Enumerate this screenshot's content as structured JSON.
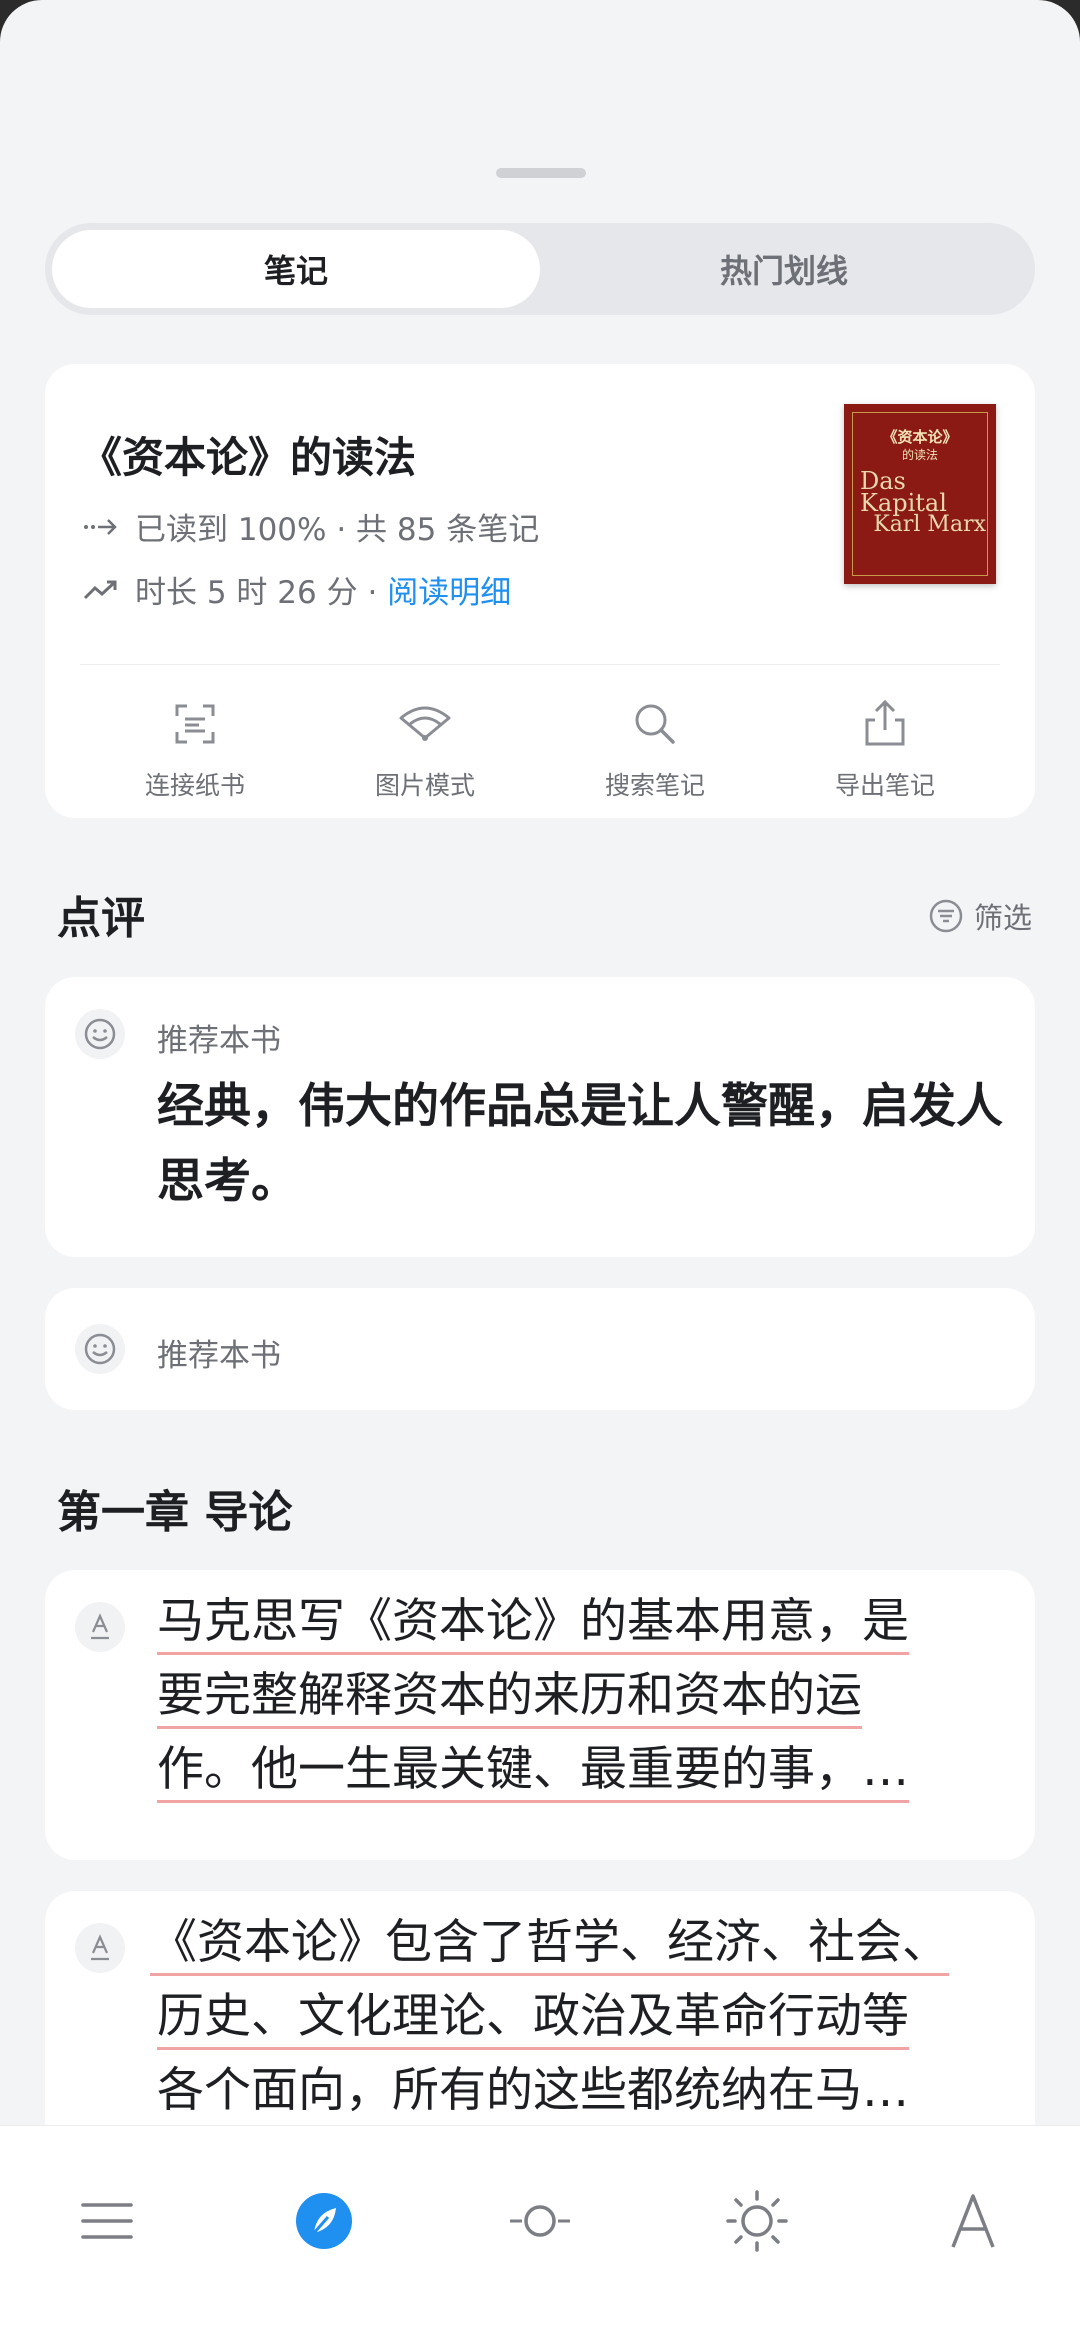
{
  "tabs": {
    "notes": "笔记",
    "hot": "热门划线"
  },
  "book": {
    "title": "《资本论》的读法",
    "progress_text": "已读到 100% · 共 85 条笔记",
    "duration_text": "时长 5 时 26 分 ·",
    "detail_link": "阅读明细",
    "cover": {
      "title": "《资本论》",
      "subtitle": "的读法",
      "das": "Das Kapital",
      "author": "Karl Marx"
    },
    "tools": [
      "连接纸书",
      "图片模式",
      "搜索笔记",
      "导出笔记"
    ]
  },
  "reviews_section": {
    "title": "点评",
    "filter": "筛选"
  },
  "reviews": [
    {
      "label": "推荐本书",
      "text": "经典，伟大的作品总是让人警醒，启发人思考。"
    },
    {
      "label": "推荐本书"
    }
  ],
  "chapter": {
    "title": "第一章 导论"
  },
  "notes": [
    {
      "lines": [
        "马克思写《资本论》的基本用意，是",
        "要完整解释资本的来历和资本的运",
        "作。他一生最关键、最重要的事，…"
      ]
    },
    {
      "lines": [
        "《资本论》包含了哲学、经济、社会、",
        "历史、文化理论、政治及革命行动等",
        "各个面向，所有的这些都统纳在马…"
      ]
    }
  ],
  "colors": {
    "accent": "#1f8ff0",
    "underline": "#f2a3a3",
    "background": "#f3f4f6"
  },
  "bottom_bar": {
    "icons": [
      "menu-icon",
      "compass-icon",
      "progress-icon",
      "brightness-icon",
      "font-icon"
    ]
  }
}
